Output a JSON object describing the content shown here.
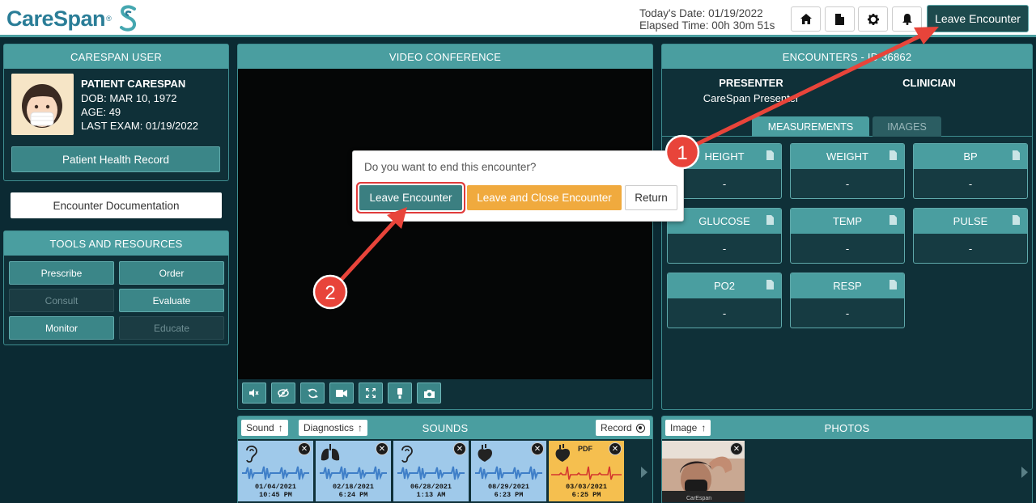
{
  "header": {
    "logo_text": "CareSpan",
    "todays_date": "Today's Date: 01/19/2022",
    "elapsed_time": "Elapsed Time: 00h 30m 51s",
    "icons": [
      "home-icon",
      "document-icon",
      "gear-icon",
      "bell-icon"
    ],
    "leave_button": "Leave Encounter"
  },
  "user_panel": {
    "title": "CARESPAN USER",
    "name": "PATIENT CARESPAN",
    "dob_label": "DOB:",
    "dob": "MAR 10, 1972",
    "age_label": "AGE:",
    "age": "49",
    "last_exam_label": "LAST EXAM:",
    "last_exam": "01/19/2022",
    "phr_button": "Patient Health Record"
  },
  "encounter_doc_button": "Encounter Documentation",
  "tools": {
    "title": "TOOLS AND RESOURCES",
    "buttons": [
      {
        "label": "Prescribe",
        "enabled": true
      },
      {
        "label": "Order",
        "enabled": true
      },
      {
        "label": "Consult",
        "enabled": false
      },
      {
        "label": "Evaluate",
        "enabled": true
      },
      {
        "label": "Monitor",
        "enabled": true
      },
      {
        "label": "Educate",
        "enabled": false
      }
    ]
  },
  "video": {
    "title": "VIDEO CONFERENCE",
    "controls": [
      "mute-icon",
      "hide-self-icon",
      "switch-camera-icon",
      "video-camera-icon",
      "fullscreen-icon",
      "flashlight-icon",
      "snapshot-camera-icon"
    ]
  },
  "dialog": {
    "question": "Do you want to end this encounter?",
    "leave": "Leave Encounter",
    "leave_close": "Leave and Close Encounter",
    "return": "Return"
  },
  "encounters": {
    "title": "ENCOUNTERS - ID 36862",
    "presenter_label": "PRESENTER",
    "presenter_value": "CareSpan Presenter",
    "clinician_label": "CLINICIAN",
    "tabs": [
      "MEASUREMENTS",
      "IMAGES"
    ],
    "active_tab": "MEASUREMENTS",
    "cards": [
      {
        "name": "HEIGHT",
        "value": "-"
      },
      {
        "name": "WEIGHT",
        "value": "-"
      },
      {
        "name": "BP",
        "value": "-"
      },
      {
        "name": "GLUCOSE",
        "value": "-"
      },
      {
        "name": "TEMP",
        "value": "-"
      },
      {
        "name": "PULSE",
        "value": "-"
      },
      {
        "name": "PO2",
        "value": "-"
      },
      {
        "name": "RESP",
        "value": "-"
      }
    ]
  },
  "sounds": {
    "title": "SOUNDS",
    "sound_btn": "Sound",
    "diag_btn": "Diagnostics",
    "record_btn": "Record",
    "items": [
      {
        "icon": "ear-icon",
        "date": "01/04/2021",
        "time": "10:45 PM"
      },
      {
        "icon": "lungs-icon",
        "date": "02/18/2021",
        "time": "6:24 PM"
      },
      {
        "icon": "ear-icon",
        "date": "06/28/2021",
        "time": "1:13 AM"
      },
      {
        "icon": "heart-icon",
        "date": "08/29/2021",
        "time": "6:23 PM"
      },
      {
        "icon": "heart-icon",
        "date": "03/03/2021",
        "time": "6:25 PM",
        "pdf": "PDF"
      }
    ]
  },
  "photos": {
    "title": "PHOTOS",
    "image_btn": "Image"
  },
  "annotations": {
    "step1": "1",
    "step2": "2"
  },
  "colors": {
    "teal_header": "#4a9ea0",
    "dark_bg": "#0b2a33",
    "panel_bg": "#0f3038",
    "orange": "#f0aa3e",
    "arrow_red": "#e8443a"
  }
}
